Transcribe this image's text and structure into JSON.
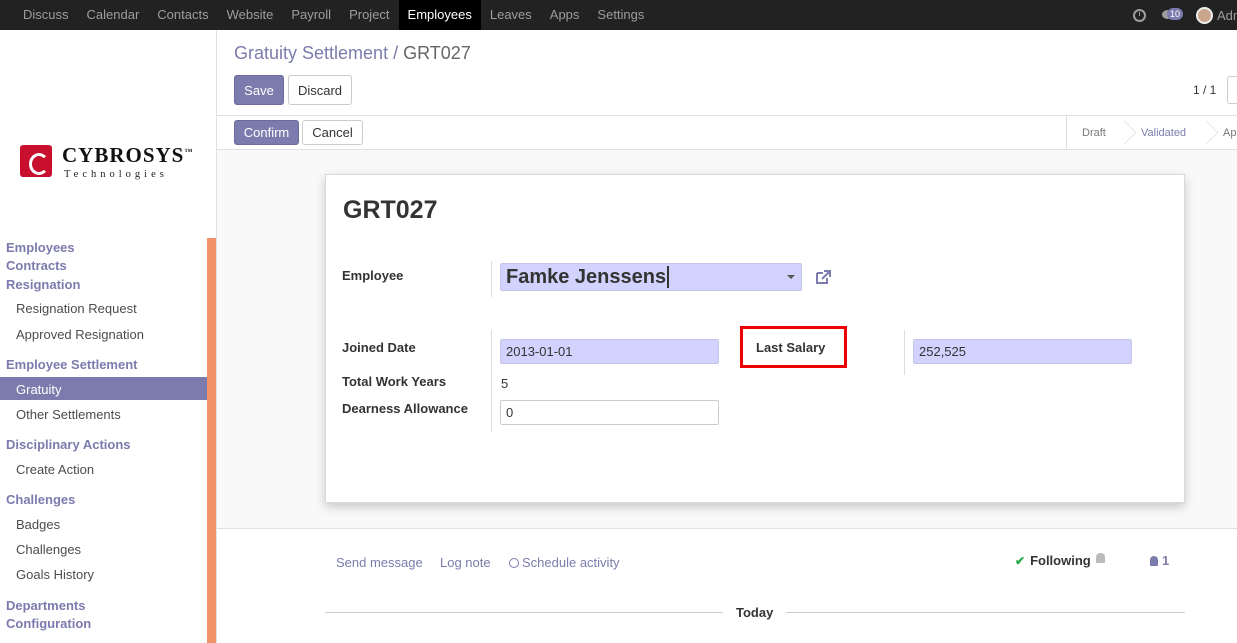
{
  "topnav": {
    "menu": [
      "Discuss",
      "Calendar",
      "Contacts",
      "Website",
      "Payroll",
      "Project",
      "Employees",
      "Leaves",
      "Apps",
      "Settings"
    ],
    "active": "Employees",
    "messages_count": "10",
    "user": "Adm"
  },
  "logo": {
    "brand": "CYBROSYS",
    "tagline": "Technologies",
    "tm": "™"
  },
  "sidebar": {
    "employees": "Employees",
    "contracts": "Contracts",
    "resignation": "Resignation",
    "resignation_request": "Resignation Request",
    "approved_resignation": "Approved Resignation",
    "employee_settlement": "Employee Settlement",
    "gratuity": "Gratuity",
    "other_settlements": "Other Settlements",
    "disciplinary_actions": "Disciplinary Actions",
    "create_action": "Create Action",
    "challenges": "Challenges",
    "badges": "Badges",
    "challenges_item": "Challenges",
    "goals_history": "Goals History",
    "departments": "Departments",
    "configuration": "Configuration"
  },
  "breadcrumb": {
    "parent": "Gratuity Settlement",
    "sep": "/",
    "current": "GRT027"
  },
  "toolbar": {
    "save": "Save",
    "discard": "Discard",
    "pager": "1 / 1"
  },
  "status_actions": {
    "confirm": "Confirm",
    "cancel": "Cancel"
  },
  "stages": {
    "draft": "Draft",
    "validated": "Validated",
    "approved": "Ap"
  },
  "form": {
    "title": "GRT027",
    "employee_label": "Employee",
    "employee_value": "Famke Jenssens",
    "joined_date_label": "Joined Date",
    "joined_date_value": "2013-01-01",
    "total_work_years_label": "Total Work Years",
    "total_work_years_value": "5",
    "dearness_allowance_label": "Dearness Allowance",
    "dearness_allowance_value": "0",
    "last_salary_label": "Last Salary",
    "last_salary_value": "252,525"
  },
  "chatter": {
    "send_message": "Send message",
    "log_note": "Log note",
    "schedule_activity": "Schedule activity",
    "following": "Following",
    "followers": "1",
    "today": "Today"
  },
  "colors": {
    "accent": "#7c7bad",
    "highlight_box": "#e00000",
    "scrollbar": "#f0936a"
  }
}
